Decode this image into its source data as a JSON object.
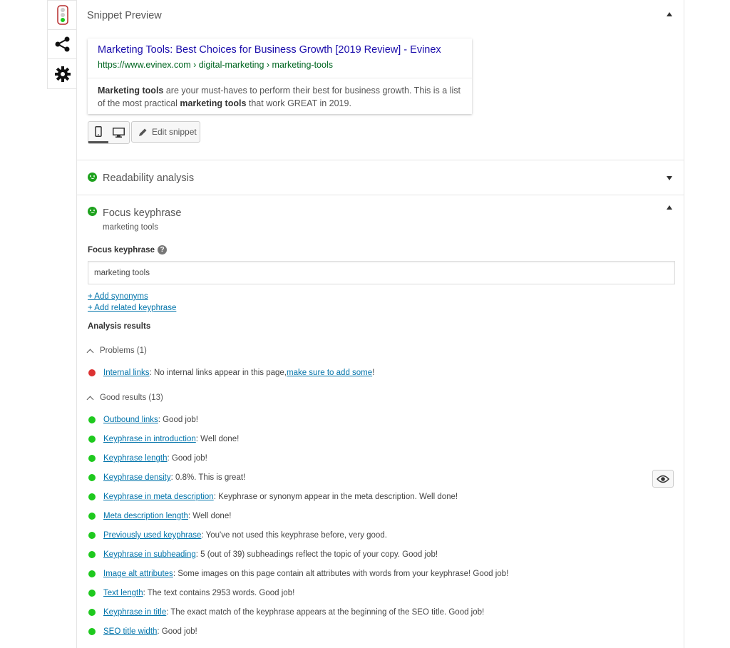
{
  "sidetabs": [
    {
      "name": "traffic-light-icon"
    },
    {
      "name": "share-icon"
    },
    {
      "name": "gear-icon"
    }
  ],
  "snippet_section": {
    "title": "Snippet Preview",
    "preview": {
      "title": "Marketing Tools: Best Choices for Business Growth [2019 Review] - Evinex",
      "url": "https://www.evinex.com › digital-marketing › marketing-tools",
      "desc_part1": "Marketing tools",
      "desc_part2": " are your must-haves to perform their best for business growth. This is a list of the most practical ",
      "desc_part3": "marketing tools",
      "desc_part4": " that work GREAT in 2019."
    },
    "edit_label": "Edit snippet"
  },
  "readability": {
    "title": "Readability analysis"
  },
  "focus": {
    "title": "Focus keyphrase",
    "subtitle": "marketing tools",
    "field_label": "Focus keyphrase",
    "field_value": "marketing tools",
    "add_synonyms": "+ Add synonyms",
    "add_related": "+ Add related keyphrase",
    "analysis_heading": "Analysis results",
    "problems_label": "Problems (1)",
    "good_label": "Good results (13)",
    "problems": [
      {
        "link": "Internal links",
        "text": ": No internal links appear in this page, ",
        "link2": "make sure to add some",
        "text2": "!"
      }
    ],
    "good": [
      {
        "link": "Outbound links",
        "text": ": Good job!"
      },
      {
        "link": "Keyphrase in introduction",
        "text": ": Well done!"
      },
      {
        "link": "Keyphrase length",
        "text": ": Good job!"
      },
      {
        "link": "Keyphrase density",
        "text": ": 0.8%. This is great!"
      },
      {
        "link": "Keyphrase in meta description",
        "text": ": Keyphrase or synonym appear in the meta description. Well done!"
      },
      {
        "link": "Meta description length",
        "text": ": Well done!"
      },
      {
        "link": "Previously used keyphrase",
        "text": ": You've not used this keyphrase before, very good."
      },
      {
        "link": "Keyphrase in subheading",
        "text": ": 5 (out of 39) subheadings reflect the topic of your copy. Good job!"
      },
      {
        "link": "Image alt attributes",
        "text": ": Some images on this page contain alt attributes with words from your keyphrase! Good job!"
      },
      {
        "link": "Text length",
        "text": ": The text contains 2953 words. Good job!"
      },
      {
        "link": "Keyphrase in title",
        "text": ": The exact match of the keyphrase appears at the beginning of the SEO title. Good job!"
      },
      {
        "link": "SEO title width",
        "text": ": Good job!"
      }
    ]
  },
  "colors": {
    "good": "#1ec91e",
    "bad": "#dc3232",
    "link": "#0073aa"
  }
}
